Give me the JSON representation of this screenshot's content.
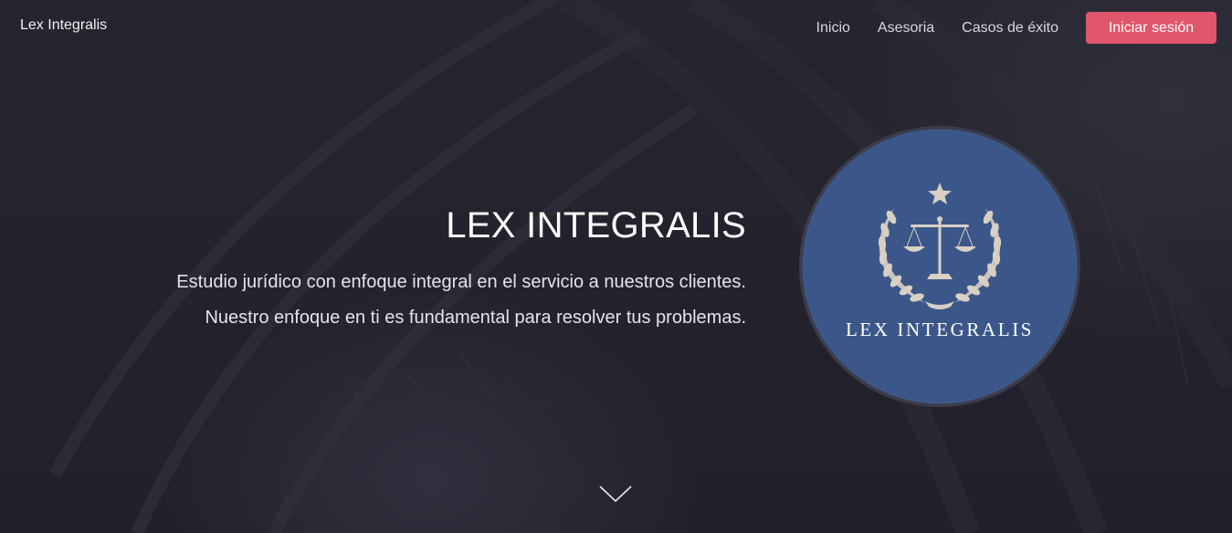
{
  "navbar": {
    "brand": "Lex Integralis",
    "links": [
      "Inicio",
      "Asesoria",
      "Casos de éxito"
    ],
    "login_label": "Iniciar sesión"
  },
  "hero": {
    "title": "LEX INTEGRALIS",
    "line1": "Estudio jurídico con enfoque integral en el servicio a nuestros clientes.",
    "line2": "Nuestro enfoque en ti es fundamental para resolver tus problemas."
  },
  "logo": {
    "text": "LEX INTEGRALIS",
    "icons": [
      "star-icon",
      "laurel-wreath-icon",
      "scales-of-justice-icon"
    ]
  },
  "icons": {
    "scroll": "chevron-down-icon"
  },
  "colors": {
    "background": "#23222d",
    "accent": "#e0566a",
    "logo_blue": "#3b5789",
    "logo_ring": "#3a3d4c",
    "logo_gold": "#d9cfc3"
  }
}
